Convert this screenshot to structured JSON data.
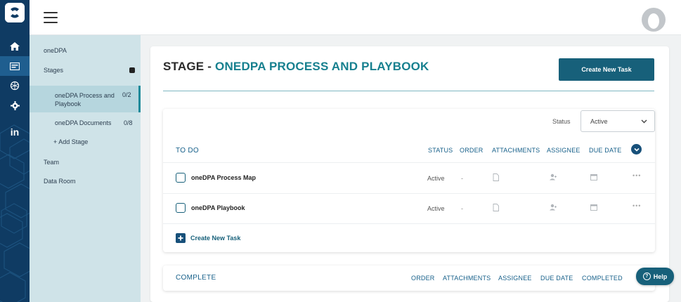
{
  "rail": {
    "icons": [
      "logo-icon",
      "home-icon",
      "stages-icon",
      "network-icon",
      "settings-icon",
      "linkedin-icon"
    ],
    "linkedin_label": "in",
    "bg_color": "#0f3b63"
  },
  "sidebar": {
    "project": "oneDPA",
    "stages_label": "Stages",
    "stage_items": [
      {
        "label_line1": "oneDPA Process and",
        "label_line2": "Playbook",
        "count": "0/2",
        "active": true
      },
      {
        "label_line1": "oneDPA Documents",
        "label_line2": "",
        "count": "0/8",
        "active": false
      }
    ],
    "add_stage": "+ Add Stage",
    "team": "Team",
    "data_room": "Data Room"
  },
  "page": {
    "title_prefix": "STAGE - ",
    "title_accent": "ONEDPA PROCESS AND PLAYBOOK",
    "create_button": "Create New Task",
    "accent_color": "#17808f"
  },
  "todo": {
    "status_label": "Status",
    "status_value": "Active",
    "section_label": "TO DO",
    "columns": [
      "STATUS",
      "ORDER",
      "ATTACHMENTS",
      "ASSIGNEE",
      "DUE DATE"
    ],
    "rows": [
      {
        "name": "oneDPA Process Map",
        "status": "Active",
        "order": "-"
      },
      {
        "name": "oneDPA Playbook",
        "status": "Active",
        "order": "-"
      }
    ],
    "more_label": "•••",
    "create_task": "Create New Task"
  },
  "complete": {
    "section_label": "COMPLETE",
    "columns": [
      "ORDER",
      "ATTACHMENTS",
      "ASSIGNEE",
      "DUE DATE",
      "COMPLETED"
    ]
  },
  "help": {
    "label": "Help",
    "q": "?"
  }
}
